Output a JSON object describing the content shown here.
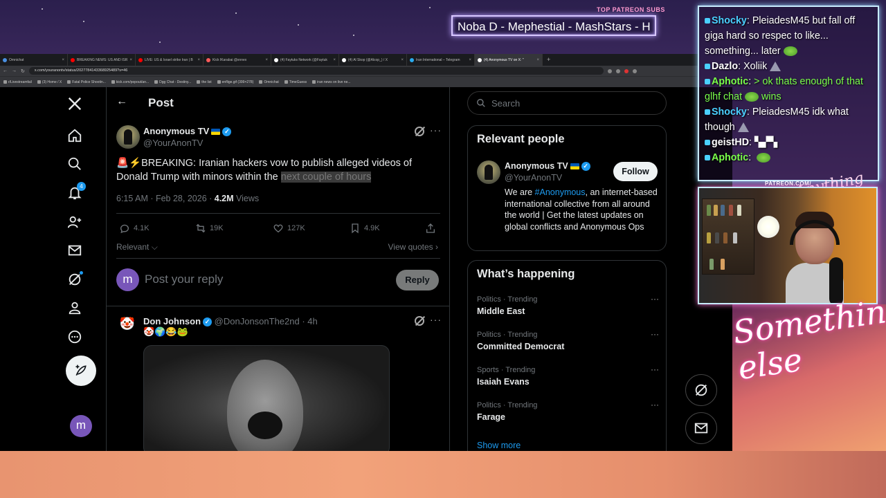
{
  "overlay": {
    "patreon_label": "TOP PATREON SUBS",
    "patreon_names": "Noba D - Mephestial - MashStars - H",
    "patreon_url": "PATREON.COM/",
    "script_small": "Anything Else",
    "script_big": "Something else"
  },
  "browser": {
    "tabs": [
      {
        "label": "Omnichat",
        "color": "#4a90e2"
      },
      {
        "label": "BREAKING NEWS: US AND ISR",
        "color": "#ff0000"
      },
      {
        "label": "LIVE: US & Israel strike Iran | B",
        "color": "#ff0000"
      },
      {
        "label": "Kick IKarabai @xnnex",
        "color": "#ff5a5a"
      },
      {
        "label": "(4) Faytuks Network (@Faytuk",
        "color": "#ffffff"
      },
      {
        "label": "(4) Al Skop (@Alcop_) / X",
        "color": "#ffffff"
      },
      {
        "label": "Iran International – Telegram",
        "color": "#2aabee"
      },
      {
        "label": "(4) Anonymous TV on X: \"",
        "color": "#ffffff"
      }
    ],
    "url": "x.com/youranontv/status/2027784143368925489?s=46",
    "bookmarks": [
      "r/Livestreamfail",
      "(3) Home / X",
      "Fatal Police Shootin...",
      "kick.com/popout/an...",
      "Dgg Chat - Destiny...",
      "the list",
      "enflige.gif (399×278)",
      "Omnichat",
      "TimeGuess",
      "iran news on live ne..."
    ]
  },
  "nav": {
    "notifications_badge": "4"
  },
  "post": {
    "header_title": "Post",
    "author_name": "Anonymous TV",
    "author_handle": "@YourAnonTV",
    "text_main": "🚨⚡BREAKING: Iranian hackers vow to publish alleged videos of Donald Trump with minors within the ",
    "text_highlight": "next couple of hours",
    "time": "6:15 AM · Feb 28, 2026 · ",
    "views_count": "4.2M",
    "views_label": " Views",
    "replies": "4.1K",
    "reposts": "19K",
    "likes": "127K",
    "bookmarks": "4.9K",
    "relevant_label": "Relevant",
    "view_quotes": "View quotes",
    "reply_avatar_letter": "m",
    "reply_placeholder": "Post your reply",
    "reply_button": "Reply"
  },
  "reply": {
    "name": "Don Johnson",
    "handle": "@DonJonsonThe2nd",
    "age": " · 4h",
    "emojis": "🤡🌍😂🐸"
  },
  "sidebar": {
    "search_placeholder": "Search",
    "relevant_title": "Relevant people",
    "person_name": "Anonymous TV",
    "person_handle": "@YourAnonTV",
    "follow_label": "Follow",
    "bio_prefix": "We are ",
    "bio_link": "#Anonymous",
    "bio_rest": ", an internet-based international collective from all around the world | Get the latest updates on global conflicts and Anonymous Ops",
    "happening_title": "What’s happening",
    "trends": [
      {
        "category": "Politics · Trending",
        "name": "Middle East"
      },
      {
        "category": "Politics · Trending",
        "name": "Committed Democrat"
      },
      {
        "category": "Sports · Trending",
        "name": "Isaiah Evans"
      },
      {
        "category": "Politics · Trending",
        "name": "Farage"
      }
    ],
    "show_more": "Show more",
    "me_letter": "m"
  },
  "chat": {
    "messages": [
      {
        "user": "Shocky",
        "color": "#4ad0ff",
        "text": "PleiadesM45 but fall off giga hard so respec to like... something... later",
        "emote": "pickle"
      },
      {
        "user": "Dazlo",
        "color": "#ffffff",
        "text": "Xoliik",
        "emote": "pyramid"
      },
      {
        "user": "Aphotic",
        "color": "#7aff4a",
        "text": "> ok thats enough of that glhf chat",
        "emote": "pickle",
        "after": " wins"
      },
      {
        "user": "Shocky",
        "color": "#4ad0ff",
        "text": "PleiadesM45 idk what though",
        "emote": "pyramid"
      },
      {
        "user": "geistHD",
        "color": "#ffffff",
        "text": "▚▞▚",
        "emote": ""
      },
      {
        "user": "Aphotic",
        "color": "#7aff4a",
        "text": "",
        "emote": "pickle"
      }
    ]
  },
  "colors": {
    "accent": "#1d9bf0",
    "background": "#000000",
    "avatar_purple": "#7856b9"
  }
}
